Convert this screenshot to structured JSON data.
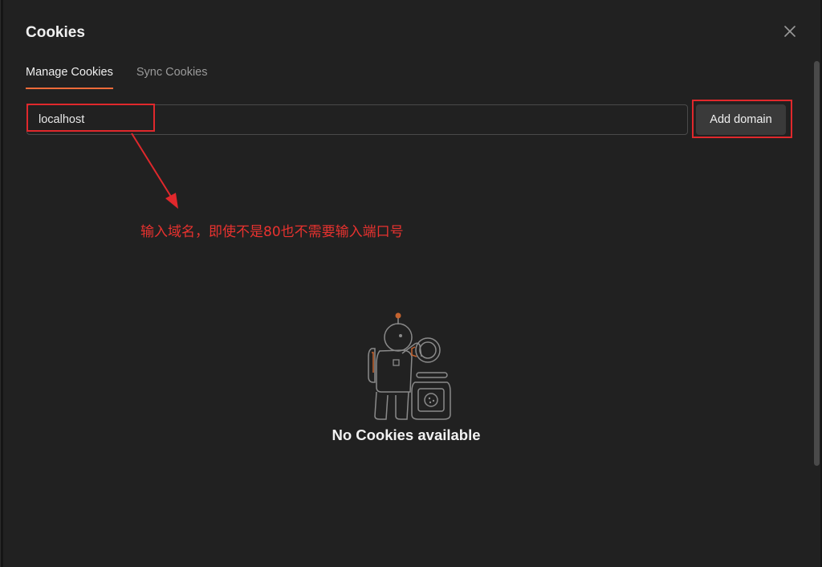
{
  "dialog": {
    "title": "Cookies",
    "close_icon": "close-icon"
  },
  "tabs": [
    {
      "label": "Manage Cookies",
      "active": true
    },
    {
      "label": "Sync Cookies",
      "active": false
    }
  ],
  "domain_input": {
    "value": "localhost"
  },
  "add_domain_button": {
    "label": "Add domain"
  },
  "annotation": {
    "text": "输入域名，即使不是80也不需要输入端口号",
    "color": "#e8322f"
  },
  "empty_state": {
    "illustration_icon": "astronaut-cookie-jar-illustration",
    "message": "No Cookies available"
  },
  "colors": {
    "accent": "#f26b3a",
    "highlight": "#e0282c",
    "background": "#212121"
  }
}
